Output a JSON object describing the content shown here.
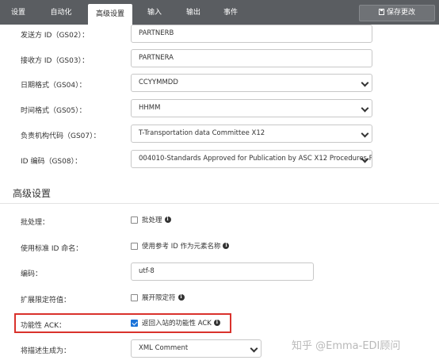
{
  "tabs": [
    "设置",
    "自动化",
    "高级设置",
    "输入",
    "输出",
    "事件"
  ],
  "save_button": "保存更改",
  "rows": [
    {
      "label": "发送方 ID（GS02）：",
      "value": "PARTNERB"
    },
    {
      "label": "接收方 ID（GS03）：",
      "value": "PARTNERA"
    },
    {
      "label": "日期格式（GS04）：",
      "value": "CCYYMMDD"
    },
    {
      "label": "时间格式（GS05）：",
      "value": "HHMM"
    },
    {
      "label": "负责机构代码（GS07）：",
      "value": "T-Transportation data Committee X12"
    },
    {
      "label": "ID 编码（GS08）：",
      "value": "004010-Standards Approved for Publication by ASC X12 Procedures R"
    }
  ],
  "advanced": {
    "title": "高级设置",
    "batch": {
      "label": "批处理：",
      "checkbox": "批处理",
      "checked": false
    },
    "std_id": {
      "label": "使用标准 ID 命名：",
      "checkbox": "使用参考 ID 作为元素名称",
      "checked": false
    },
    "encoding": {
      "label": "编码：",
      "value": "utf-8"
    },
    "qualifier": {
      "label": "扩展限定符值：",
      "checkbox": "展开限定符",
      "checked": false
    },
    "ack": {
      "label": "功能性 ACK：",
      "checkbox": "返回入站的功能性 ACK",
      "checked": true
    },
    "desc_as": {
      "label": "将描述生成为：",
      "value": "XML Comment"
    }
  },
  "watermark": "知乎 @Emma-EDI顾问",
  "colors": {
    "topbar": "#5a5d61",
    "highlight": "#d9322c",
    "checkbox_checked": "#1a73d9"
  }
}
